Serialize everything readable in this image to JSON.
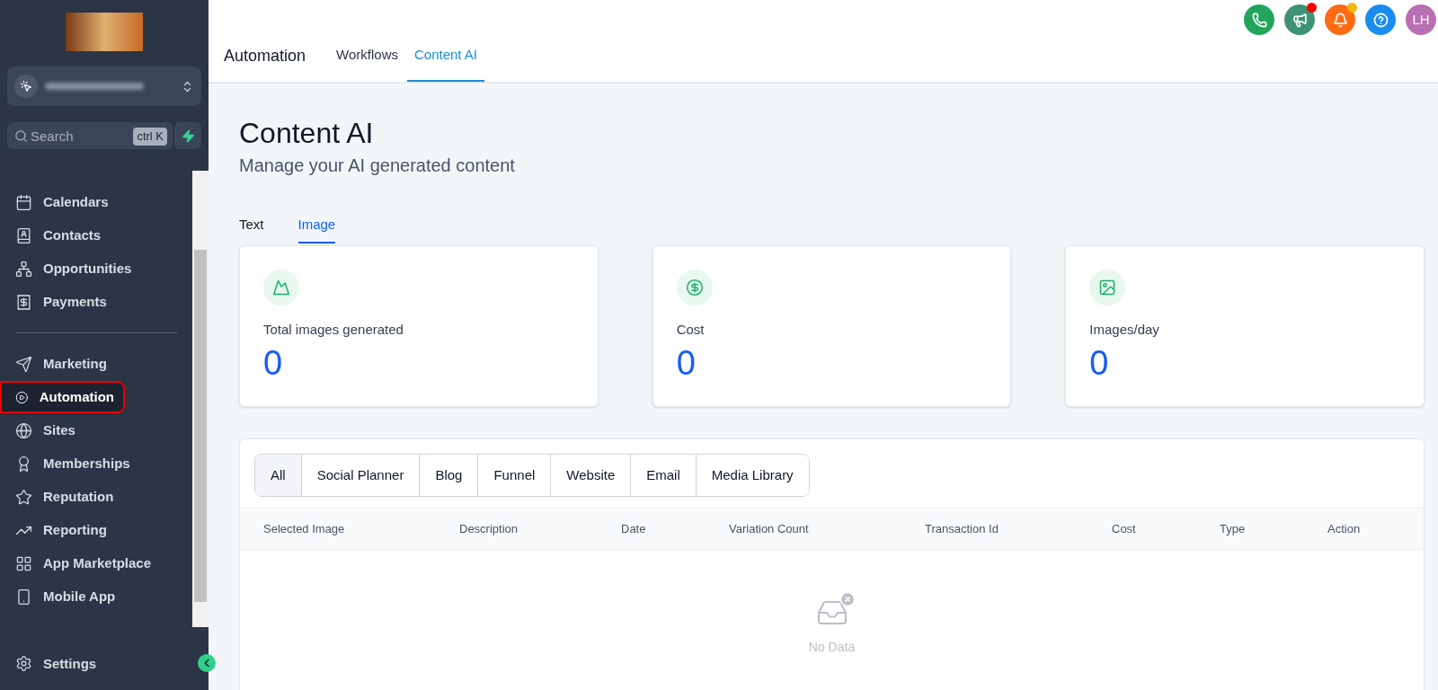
{
  "sidebar": {
    "search": {
      "placeholder": "Search",
      "shortcut": "ctrl K"
    },
    "items": [
      {
        "label": "Calendars",
        "selected": false
      },
      {
        "label": "Contacts",
        "selected": false
      },
      {
        "label": "Opportunities",
        "selected": false
      },
      {
        "label": "Payments",
        "selected": false
      },
      {
        "label": "Marketing",
        "selected": false
      },
      {
        "label": "Automation",
        "selected": true
      },
      {
        "label": "Sites",
        "selected": false
      },
      {
        "label": "Memberships",
        "selected": false
      },
      {
        "label": "Reputation",
        "selected": false
      },
      {
        "label": "Reporting",
        "selected": false
      },
      {
        "label": "App Marketplace",
        "selected": false
      },
      {
        "label": "Mobile App",
        "selected": false
      }
    ],
    "settings": {
      "label": "Settings"
    }
  },
  "header": {
    "title": "Automation",
    "tabs": [
      {
        "label": "Workflows",
        "selected": false
      },
      {
        "label": "Content AI",
        "selected": true
      }
    ],
    "actions": [
      {
        "dot": false
      },
      {
        "dot": true
      },
      {
        "dot": true
      },
      {
        "dot": false
      }
    ],
    "avatar": {
      "initials": "LH"
    }
  },
  "page": {
    "title": "Content AI",
    "subtitle": "Manage your AI generated content",
    "tabs": [
      {
        "label": "Text",
        "selected": false
      },
      {
        "label": "Image",
        "selected": true
      }
    ],
    "stats": [
      {
        "label": "Total images generated",
        "value": "0"
      },
      {
        "label": "Cost",
        "value": "0"
      },
      {
        "label": "Images/day",
        "value": "0"
      }
    ],
    "filters": [
      {
        "label": "All",
        "selected": true
      },
      {
        "label": "Social Planner",
        "selected": false
      },
      {
        "label": "Blog",
        "selected": false
      },
      {
        "label": "Funnel",
        "selected": false
      },
      {
        "label": "Website",
        "selected": false
      },
      {
        "label": "Email",
        "selected": false
      },
      {
        "label": "Media Library",
        "selected": false
      }
    ],
    "table": {
      "columns": [
        "Selected Image",
        "Description",
        "Date",
        "Variation Count",
        "Transaction Id",
        "Cost",
        "Type",
        "Action"
      ],
      "empty": "No Data"
    }
  }
}
